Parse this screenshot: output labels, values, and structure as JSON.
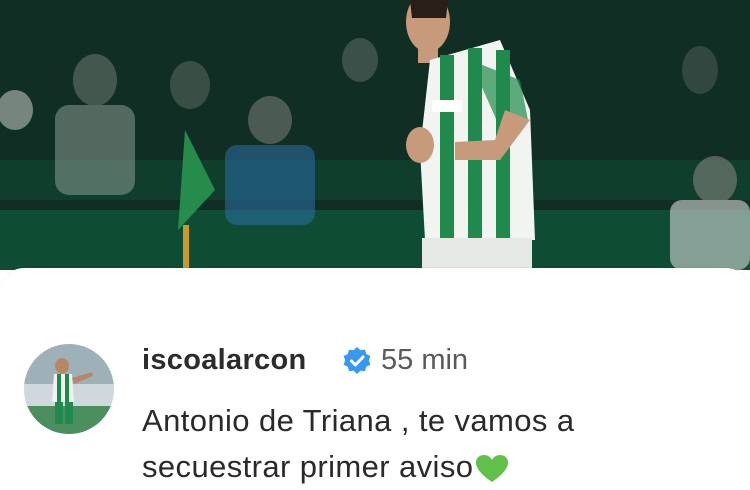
{
  "post": {
    "image_icon": "stadium-player-photo",
    "username": "iscoalarcon",
    "verified_icon": "verified-badge-icon",
    "time": "55 min",
    "caption_line1": "Antonio de Triana , te vamos a",
    "caption_line2": "secuestrar primer aviso",
    "heart_icon": "green-heart-icon"
  },
  "colors": {
    "verified_blue": "#3897f0",
    "heart_green": "#5fc14a",
    "kit_green": "#1f8a4c"
  }
}
